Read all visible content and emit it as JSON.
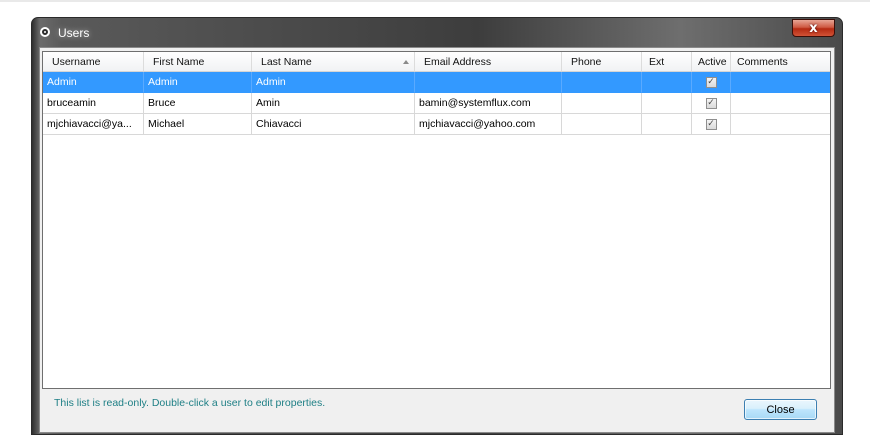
{
  "window": {
    "title": "Users",
    "close_glyph": "x"
  },
  "grid": {
    "columns": [
      {
        "label": "Username",
        "sorted": ""
      },
      {
        "label": "First Name",
        "sorted": ""
      },
      {
        "label": "Last Name",
        "sorted": "ascending"
      },
      {
        "label": "Email Address",
        "sorted": ""
      },
      {
        "label": "Phone",
        "sorted": ""
      },
      {
        "label": "Ext",
        "sorted": ""
      },
      {
        "label": "Active",
        "sorted": ""
      },
      {
        "label": "Comments",
        "sorted": ""
      }
    ],
    "rows": [
      {
        "username": "Admin",
        "first": "Admin",
        "last": "Admin",
        "email": "",
        "phone": "",
        "ext": "",
        "active": true,
        "comments": "",
        "selected": true
      },
      {
        "username": "bruceamin",
        "first": "Bruce",
        "last": "Amin",
        "email": "bamin@systemflux.com",
        "phone": "",
        "ext": "",
        "active": true,
        "comments": "",
        "selected": false
      },
      {
        "username": "mjchiavacci@ya...",
        "first": "Michael",
        "last": "Chiavacci",
        "email": "mjchiavacci@yahoo.com",
        "phone": "",
        "ext": "",
        "active": true,
        "comments": "",
        "selected": false
      }
    ]
  },
  "footer": {
    "hint": "This list is read-only. Double-click a user to edit properties.",
    "close_label": "Close"
  },
  "colors": {
    "selection": "#3399ff",
    "hint_text": "#1e7f85"
  },
  "icons": {
    "title": "window-app-icon",
    "checkbox": "checkmark-icon",
    "sort": "sort-ascending-icon"
  }
}
